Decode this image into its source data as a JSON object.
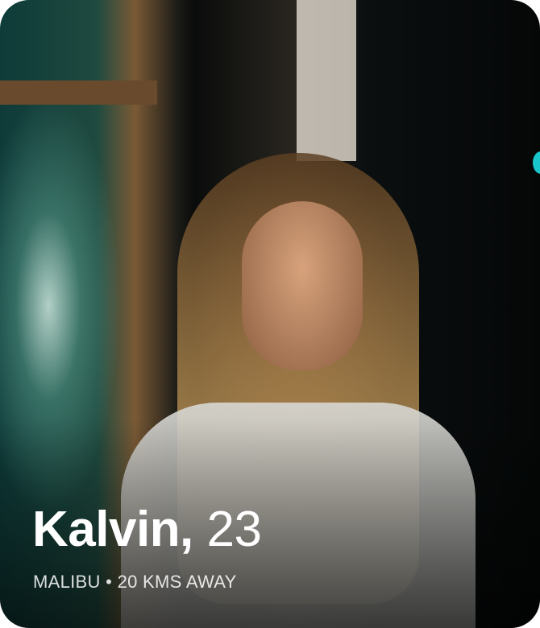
{
  "profile": {
    "name": "Kalvin,",
    "age": "23",
    "location": "MALIBU",
    "separator": "•",
    "distance": "20 KMS AWAY"
  },
  "colors": {
    "accent": "#18c6cc",
    "text": "#ffffff"
  }
}
